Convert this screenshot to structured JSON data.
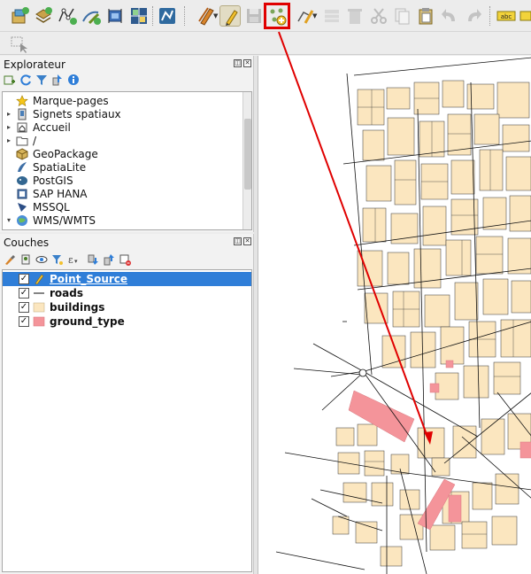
{
  "toolbar": {
    "main_icons": [
      "new-layer-icon",
      "new-spatialite-icon",
      "new-vector-icon",
      "digitize-icon",
      "plugin-icon",
      "georeferencer-icon",
      "vertex-tool-icon",
      "current-edits-icon",
      "toggle-editing-icon",
      "save-edits-icon",
      "add-point-feature-icon",
      "vertex-tool-dropdown-icon",
      "modify-attributes-icon",
      "delete-selected-icon",
      "cut-features-icon",
      "copy-features-icon",
      "paste-features-icon",
      "undo-icon",
      "redo-icon",
      "label-abc-icon",
      "label-style-icon"
    ],
    "label_abc": "abc"
  },
  "browser": {
    "title": "Explorateur",
    "items": [
      {
        "label": "Marque-pages",
        "icon": "star-icon",
        "expandable": false
      },
      {
        "label": "Signets spatiaux",
        "icon": "bookmark-icon",
        "expandable": true
      },
      {
        "label": "Accueil",
        "icon": "home-icon",
        "expandable": true
      },
      {
        "label": "/",
        "icon": "folder-icon",
        "expandable": true
      },
      {
        "label": "GeoPackage",
        "icon": "geopackage-icon",
        "expandable": false
      },
      {
        "label": "SpatiaLite",
        "icon": "spatialite-icon",
        "expandable": false
      },
      {
        "label": "PostGIS",
        "icon": "postgis-icon",
        "expandable": false
      },
      {
        "label": "SAP HANA",
        "icon": "saphana-icon",
        "expandable": false
      },
      {
        "label": "MSSQL",
        "icon": "mssql-icon",
        "expandable": false
      },
      {
        "label": "WMS/WMTS",
        "icon": "wms-icon",
        "expandable": true
      }
    ]
  },
  "layers": {
    "title": "Couches",
    "items": [
      {
        "label": "Point_Source",
        "checked": true,
        "selected": true,
        "symbol": "pencil"
      },
      {
        "label": "roads",
        "checked": true,
        "selected": false,
        "symbol": "line"
      },
      {
        "label": "buildings",
        "checked": true,
        "selected": false,
        "symbol": "fill",
        "color": "#fbe6bf"
      },
      {
        "label": "ground_type",
        "checked": true,
        "selected": false,
        "symbol": "fill",
        "color": "#f4949a"
      }
    ]
  },
  "colors": {
    "building_fill": "#fbe6bf",
    "building_stroke": "#333333",
    "ground_fill": "#f4949a",
    "annotation": "#e00000",
    "selection": "#2f7ed8"
  }
}
